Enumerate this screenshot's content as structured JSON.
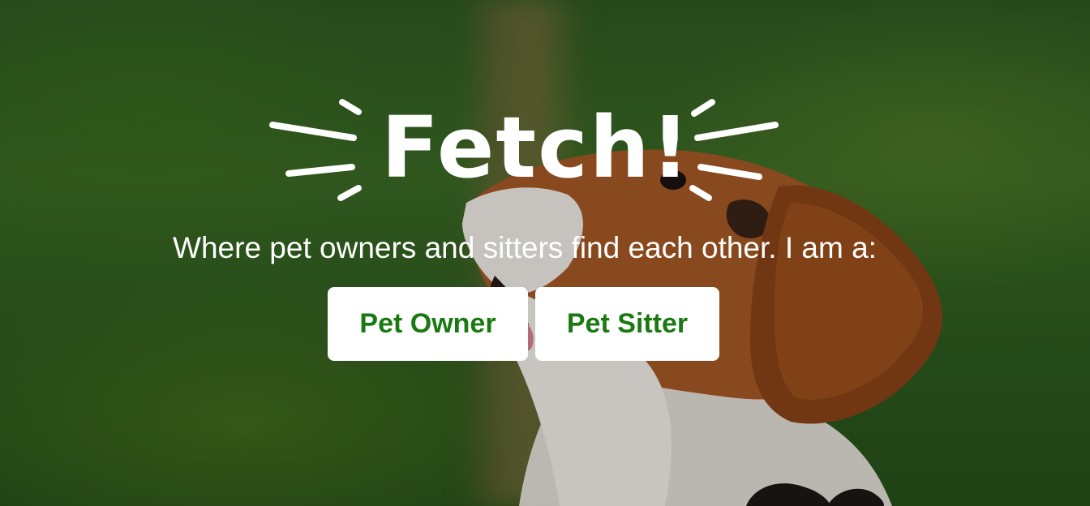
{
  "logo": {
    "text": "Fetch!"
  },
  "hero": {
    "tagline": "Where pet owners and sitters find each other. I am a:"
  },
  "actions": {
    "pet_owner_label": "Pet Owner",
    "pet_sitter_label": "Pet Sitter"
  },
  "colors": {
    "button_text": "#1a7a12",
    "button_bg": "#ffffff",
    "text": "#ffffff"
  }
}
